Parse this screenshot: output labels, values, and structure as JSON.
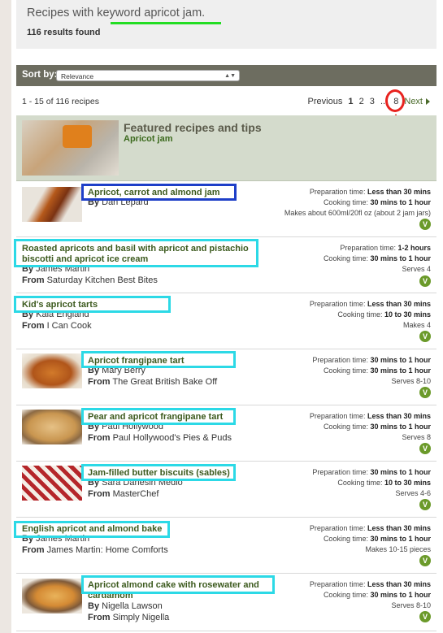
{
  "header": {
    "title": "Recipes with keyword apricot jam.",
    "count": "116 results found"
  },
  "sort": {
    "label": "Sort by:",
    "value": "Relevance"
  },
  "pager": {
    "range": "1 - 15 of 116 recipes",
    "previous": "Previous",
    "pages": [
      "1",
      "2",
      "3"
    ],
    "ellipsis": "...",
    "last": "8",
    "next": "Next"
  },
  "featured": {
    "title": "Featured recipes and tips",
    "subtitle": "Apricot jam"
  },
  "recipes": [
    {
      "title": "Apricot, carrot and almond jam",
      "by_label": "By",
      "author": "Dan Lepard",
      "from_label": "",
      "source": "",
      "prep_label": "Preparation time:",
      "prep": "Less than 30 mins",
      "cook_label": "Cooking time:",
      "cook": "30 mins to 1 hour",
      "serves": "Makes about 600ml/20fl oz (about 2 jam jars)",
      "badge": "V"
    },
    {
      "title": "Roasted apricots and basil with apricot and pistachio biscotti and apricot ice cream",
      "by_label": "By",
      "author": "James Martin",
      "from_label": "From",
      "source": "Saturday Kitchen Best Bites",
      "prep_label": "Preparation time:",
      "prep": "1-2 hours",
      "cook_label": "Cooking time:",
      "cook": "30 mins to 1 hour",
      "serves": "Serves 4",
      "badge": "V"
    },
    {
      "title": "Kid's apricot tarts",
      "by_label": "By",
      "author": "Kala England",
      "from_label": "From",
      "source": "I Can Cook",
      "prep_label": "Preparation time:",
      "prep": "Less than 30 mins",
      "cook_label": "Cooking time:",
      "cook": "10 to 30 mins",
      "serves": "Makes 4",
      "badge": "V"
    },
    {
      "title": "Apricot frangipane tart",
      "by_label": "By",
      "author": "Mary Berry",
      "from_label": "From",
      "source": "The Great British Bake Off",
      "prep_label": "Preparation time:",
      "prep": "30 mins to 1 hour",
      "cook_label": "Cooking time:",
      "cook": "30 mins to 1 hour",
      "serves": "Serves 8-10",
      "badge": "V"
    },
    {
      "title": "Pear and apricot frangipane tart",
      "by_label": "By",
      "author": "Paul Hollywood",
      "from_label": "From",
      "source": "Paul Hollywood's Pies & Puds",
      "prep_label": "Preparation time:",
      "prep": "Less than 30 mins",
      "cook_label": "Cooking time:",
      "cook": "30 mins to 1 hour",
      "serves": "Serves 8",
      "badge": "V"
    },
    {
      "title": "Jam-filled butter biscuits (sables)",
      "by_label": "By",
      "author": "Sara Danesin Medio",
      "from_label": "From",
      "source": "MasterChef",
      "prep_label": "Preparation time:",
      "prep": "30 mins to 1 hour",
      "cook_label": "Cooking time:",
      "cook": "10 to 30 mins",
      "serves": "Serves 4-6",
      "badge": "V"
    },
    {
      "title": "English apricot and almond bake",
      "by_label": "By",
      "author": "James Martin",
      "from_label": "From",
      "source": "James Martin: Home Comforts",
      "prep_label": "Preparation time:",
      "prep": "Less than 30 mins",
      "cook_label": "Cooking time:",
      "cook": "30 mins to 1 hour",
      "serves": "Makes 10-15 pieces",
      "badge": "V"
    },
    {
      "title": "Apricot almond cake with rosewater and cardamom",
      "by_label": "By",
      "author": "Nigella Lawson",
      "from_label": "From",
      "source": "Simply Nigella",
      "prep_label": "Preparation time:",
      "prep": "Less than 30 mins",
      "cook_label": "Cooking time:",
      "cook": "30 mins to 1 hour",
      "serves": "Serves 8-10",
      "badge": "V"
    }
  ]
}
